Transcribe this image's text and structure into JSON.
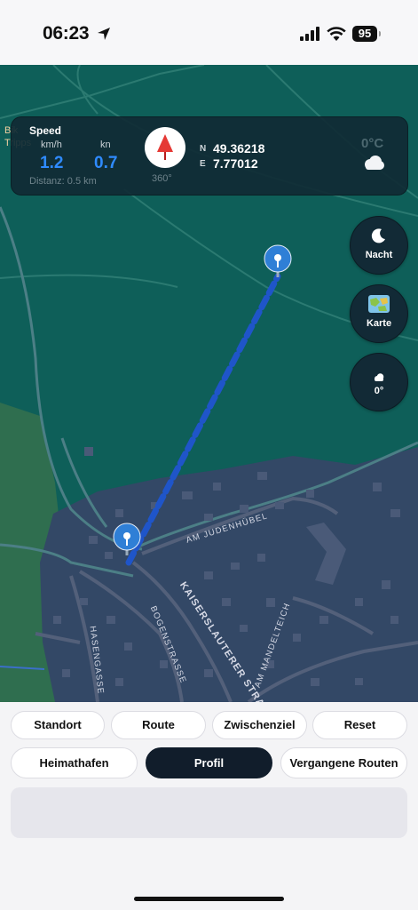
{
  "status_bar": {
    "time": "06:23",
    "battery": "95"
  },
  "map": {
    "edge_label_1": "Bik",
    "edge_label_2": "Tripps",
    "street_labels": {
      "am_judenhuebel": "AM JUDENHÜBEL",
      "kaiserslauterer": "KAISERSLAUTERER STRA",
      "bogenstrasse": "BOGENSTRASSE",
      "hasengasse": "HASENGASSE",
      "am_mandelteich": "AM MANDELTEICH"
    }
  },
  "info_panel": {
    "speed_title": "Speed",
    "unit_kmh": "km/h",
    "unit_kn": "kn",
    "speed_kmh": "1.2",
    "speed_kn": "0.7",
    "distance": "Distanz: 0.5 km",
    "heading": "360°",
    "n_label": "N",
    "e_label": "E",
    "latitude": "49.36218",
    "longitude": "7.77012",
    "temperature": "0°C",
    "weather_icon": "cloud-icon"
  },
  "map_buttons": {
    "night_label": "Nacht",
    "map_label": "Karte",
    "wind_label": "0°"
  },
  "controls": {
    "row1": [
      "Standort",
      "Route",
      "Zwischenziel",
      "Reset"
    ],
    "row2": [
      "Heimathafen",
      "Profil",
      "Vergangene Routen"
    ],
    "active": "Profil"
  },
  "colors": {
    "route_line": "#1f55c9",
    "pin": "#2f7fd6",
    "map_water": "#0e5f59",
    "town": "#334866",
    "accent_blue": "#2f8bff",
    "active_pill": "#111d2b"
  }
}
